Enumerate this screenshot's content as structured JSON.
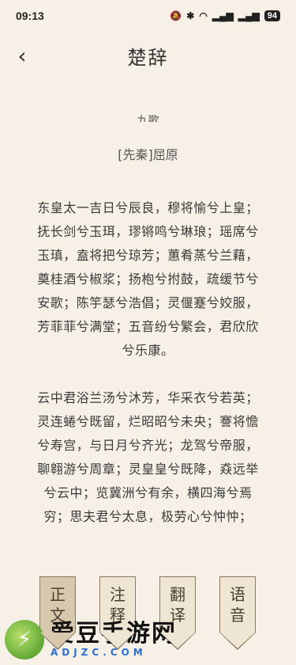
{
  "status_bar": {
    "time": "09:13",
    "icons": [
      "mute-icon",
      "bluetooth-icon",
      "wifi-icon",
      "signal-5g-1-icon",
      "signal-5g-2-icon"
    ],
    "battery": "94"
  },
  "header": {
    "back_glyph": "‹",
    "title": "楚辞"
  },
  "content": {
    "partial_title": "九歌",
    "author": "[先秦]屈原",
    "paragraphs": [
      "东皇太一吉日兮辰良，穆将愉兮上皇；抚长剑兮玉珥，璆锵鸣兮琳琅；瑶席兮玉瑱，盍将把兮琼芳；蕙肴蒸兮兰藉，奠桂酒兮椒浆；扬枹兮拊鼓，疏缓节兮安歌；陈竽瑟兮浩倡；灵偃蹇兮姣服，芳菲菲兮满堂；五音纷兮繁会，君欣欣兮乐康。",
      "云中君浴兰汤兮沐芳，华采衣兮若英；灵连蜷兮既留，烂昭昭兮未央；謇将憺兮寿宫，与日月兮齐光；龙驾兮帝服，聊翱游兮周章；灵皇皇兮既降，猋远举兮云中；览冀洲兮有余，横四海兮焉穷；思夫君兮太息，极劳心兮忡忡；"
    ]
  },
  "tabs": [
    {
      "label_1": "正",
      "label_2": "文"
    },
    {
      "label_1": "注",
      "label_2": "释"
    },
    {
      "label_1": "翻",
      "label_2": "译"
    },
    {
      "label_1": "语",
      "label_2": "音"
    }
  ],
  "watermark": {
    "title": "爱豆手游网",
    "domain": "ADJZC.COM"
  }
}
